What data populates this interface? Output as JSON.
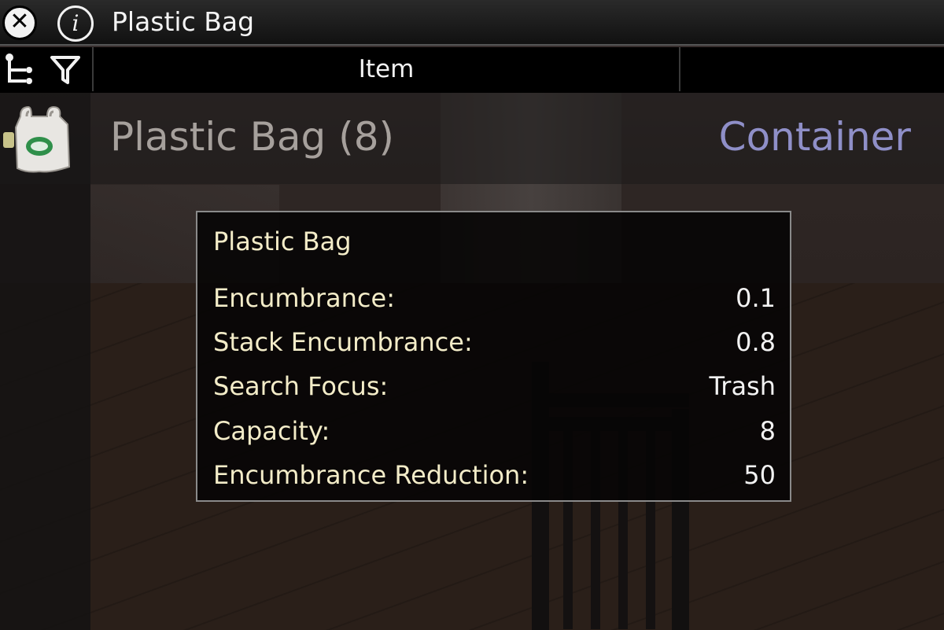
{
  "window": {
    "title": "Plastic Bag",
    "close_icon": "close-icon",
    "info_icon": "info-icon",
    "info_glyph": "i"
  },
  "columns": {
    "item_header": "Item",
    "tree_icon": "tree-view-icon",
    "filter_icon": "filter-icon"
  },
  "row": {
    "icon": "plastic-bag-icon",
    "name": "Plastic Bag (8)",
    "type": "Container",
    "type_color": "#8f8fc8"
  },
  "tooltip": {
    "title": "Plastic Bag",
    "properties": [
      {
        "label": "Encumbrance:",
        "value": "0.1"
      },
      {
        "label": "Stack Encumbrance:",
        "value": "0.8"
      },
      {
        "label": "Search Focus:",
        "value": "Trash"
      },
      {
        "label": "Capacity:",
        "value": "8"
      },
      {
        "label": "Encumbrance Reduction:",
        "value": "50"
      }
    ]
  }
}
